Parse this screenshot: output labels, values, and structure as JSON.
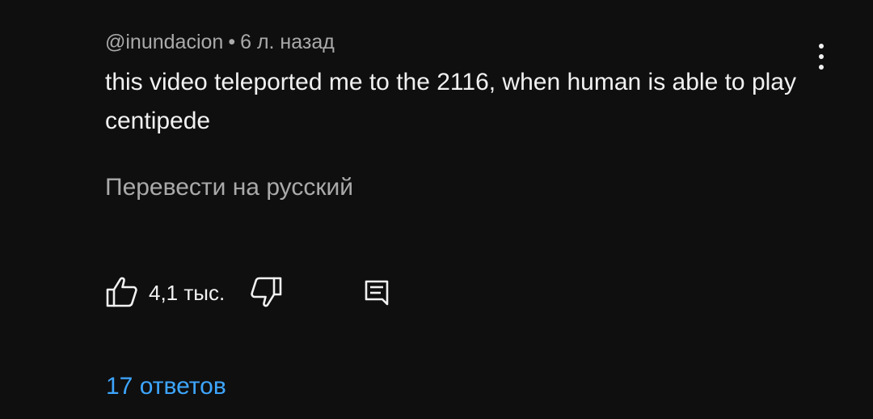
{
  "comment": {
    "author": "@inundacion",
    "separator": "•",
    "time": "6 л. назад",
    "text": "this video teleported me to the 2116, when human is able to play centipede",
    "translate_label": "Перевести на русский",
    "like_count": "4,1 тыс.",
    "replies_label": "17 ответов"
  },
  "icons": {
    "more": "more-vert-icon",
    "like": "thumb-up-icon",
    "dislike": "thumb-down-icon",
    "reply": "comment-icon"
  },
  "colors": {
    "background": "#0f0f0f",
    "text_primary": "#f1f1f1",
    "text_secondary": "#aaaaaa",
    "link": "#3ea6ff"
  }
}
